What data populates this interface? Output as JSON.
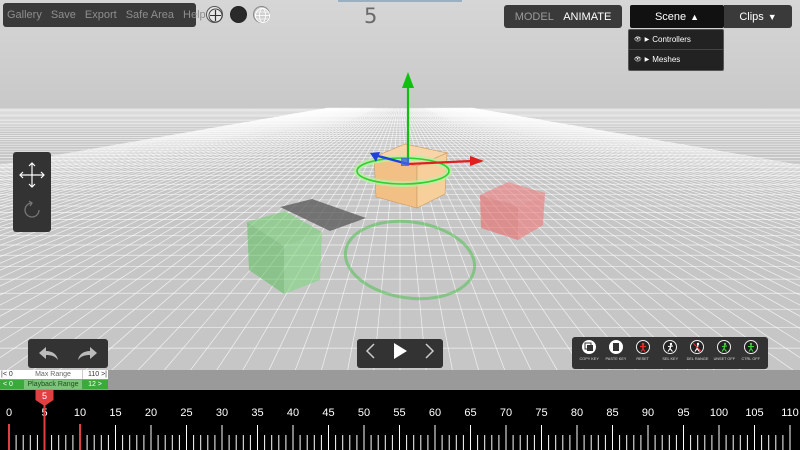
{
  "menu": {
    "items": [
      "Gallery",
      "Save",
      "Export",
      "Safe Area",
      "Help"
    ]
  },
  "view_buttons": {
    "items": [
      "compass-icon",
      "sphere-icon",
      "grid-sphere-icon"
    ]
  },
  "frame_indicator": {
    "value": "5"
  },
  "mode_toggle": {
    "model": "MODEL",
    "animate": "ANIMATE",
    "active": "ANIMATE"
  },
  "scene_menu": {
    "label": "Scene",
    "arrow": "▲",
    "items": [
      {
        "label": "Controllers",
        "eye": "👁",
        "arrow": "▶"
      },
      {
        "label": "Meshes",
        "eye": "👁",
        "arrow": "▶"
      }
    ]
  },
  "clips_menu": {
    "label": "Clips",
    "arrow": "▼"
  },
  "transform_tools": {
    "items": [
      "move-icon",
      "rotate-icon"
    ]
  },
  "history": {
    "items": [
      "undo-icon",
      "redo-icon"
    ]
  },
  "playback": {
    "items": [
      "prev-frame-icon",
      "play-icon",
      "next-frame-icon"
    ]
  },
  "keyframe_tools": {
    "items": [
      {
        "label": "COPY KEY",
        "icon": "copy-key-icon"
      },
      {
        "label": "PASTE KEY",
        "icon": "paste-key-icon"
      },
      {
        "label": "RESET",
        "icon": "reset-icon"
      },
      {
        "label": "SEL KEY",
        "icon": "select-key-icon"
      },
      {
        "label": "DEL RANGE",
        "icon": "delete-range-icon"
      },
      {
        "label": "UNSET OFF",
        "icon": "unset-off-icon"
      },
      {
        "label": "CTRL OFF",
        "icon": "ctrl-off-icon"
      }
    ]
  },
  "max_range": {
    "start": "|< 0",
    "label": "Max Range",
    "end": "110 >|"
  },
  "playback_range": {
    "start": "< 0",
    "label": "Playback Range",
    "end": "12 >"
  },
  "timeline": {
    "ticks": [
      "0",
      "5",
      "10",
      "15",
      "20",
      "25",
      "30",
      "35",
      "40",
      "45",
      "50",
      "55",
      "60",
      "65",
      "70",
      "75",
      "80",
      "85",
      "90",
      "95",
      "100",
      "105",
      "110"
    ],
    "current_frame": "5",
    "current_value": 5,
    "range_start": 0,
    "range_end": 10,
    "max": 110
  },
  "colors": {
    "panel": "#3a3a3a",
    "accent_green": "#3aaa3a",
    "playhead_red": "#e04040",
    "axis_x": "#e02020",
    "axis_y": "#10c010",
    "axis_z": "#2040e0"
  }
}
